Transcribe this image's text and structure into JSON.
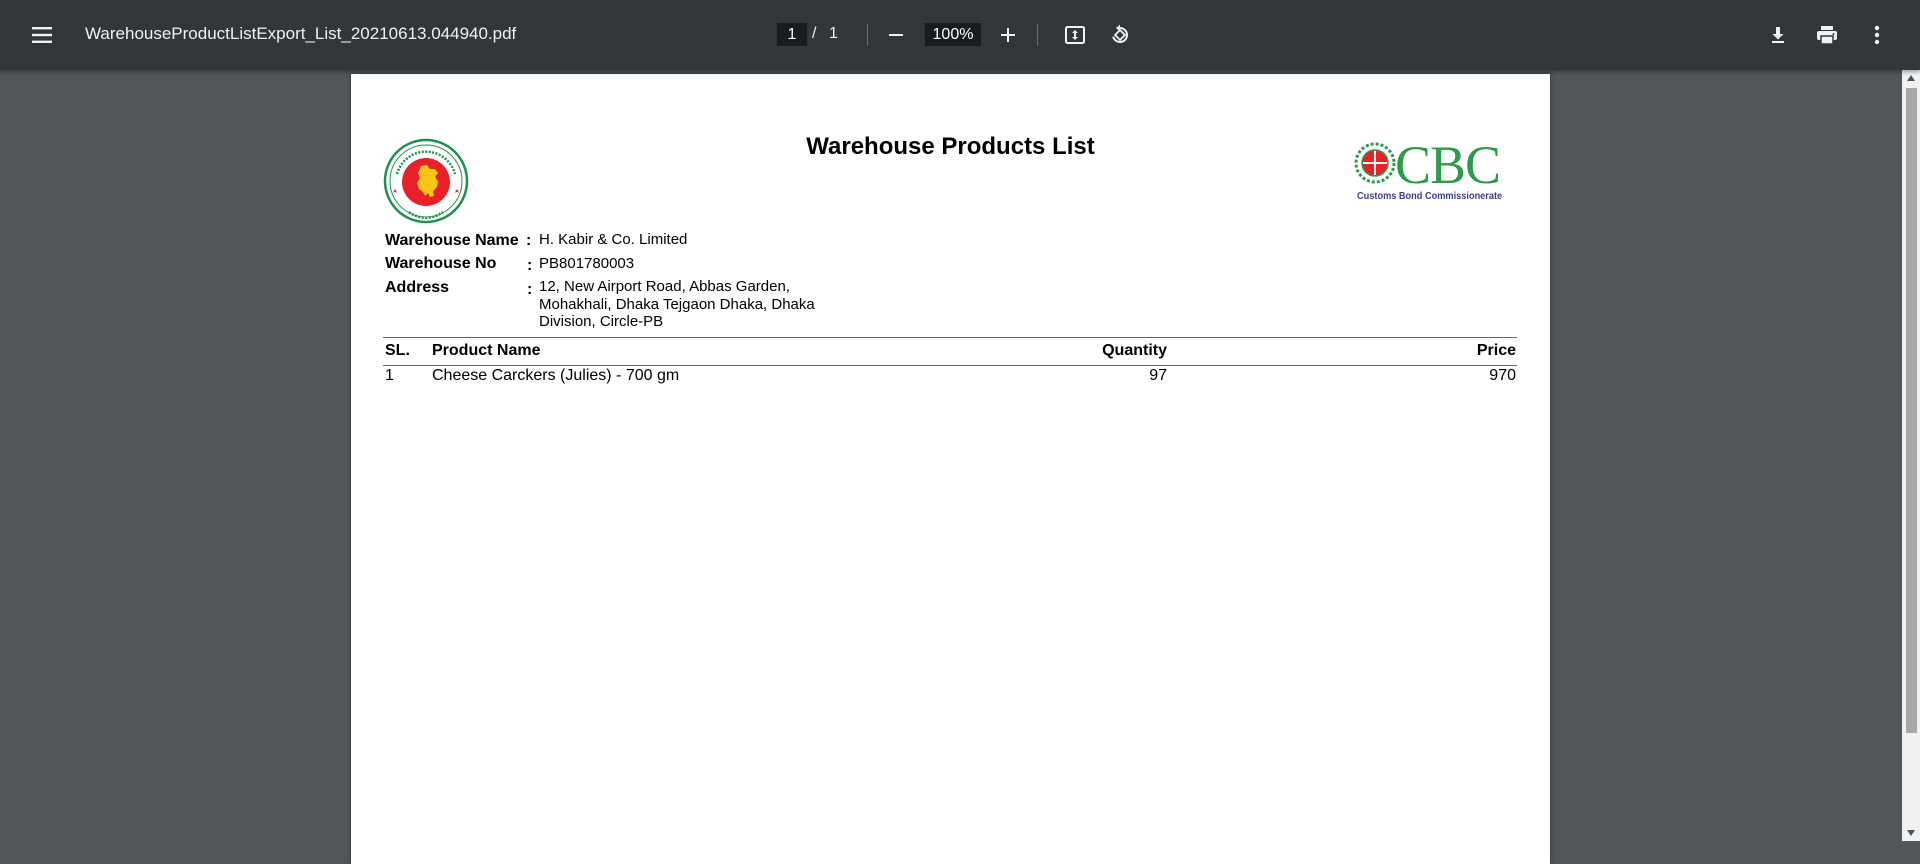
{
  "toolbar": {
    "filename": "WarehouseProductListExport_List_20210613.044940.pdf",
    "page_current": "1",
    "page_separator": "/",
    "page_total": "1",
    "zoom": "100%"
  },
  "document": {
    "title": "Warehouse Products List",
    "logo_right": {
      "text": "CBC",
      "subtitle": "Customs Bond Commissionerate"
    },
    "info": [
      {
        "label": "Warehouse Name",
        "colon": ":",
        "value": "H. Kabir & Co. Limited"
      },
      {
        "label": "Warehouse No",
        "colon": ":",
        "value": "PB801780003"
      },
      {
        "label": "Address",
        "colon": ":",
        "value": "12, New Airport Road, Abbas Garden, Mohakhali, Dhaka Tejgaon Dhaka, Dhaka Division, Circle-PB"
      }
    ],
    "table": {
      "headers": [
        "SL.",
        "Product Name",
        "Quantity",
        "Price"
      ],
      "rows": [
        [
          "1",
          "Cheese Carckers (Julies) - 700 gm",
          "97",
          "970"
        ]
      ]
    }
  },
  "colors": {
    "toolbar_bg": "#323639",
    "viewer_bg": "#525659",
    "emblem_green": "#1e8f4e",
    "emblem_red": "#e8202a",
    "cbc_green": "#2e9a4b"
  }
}
